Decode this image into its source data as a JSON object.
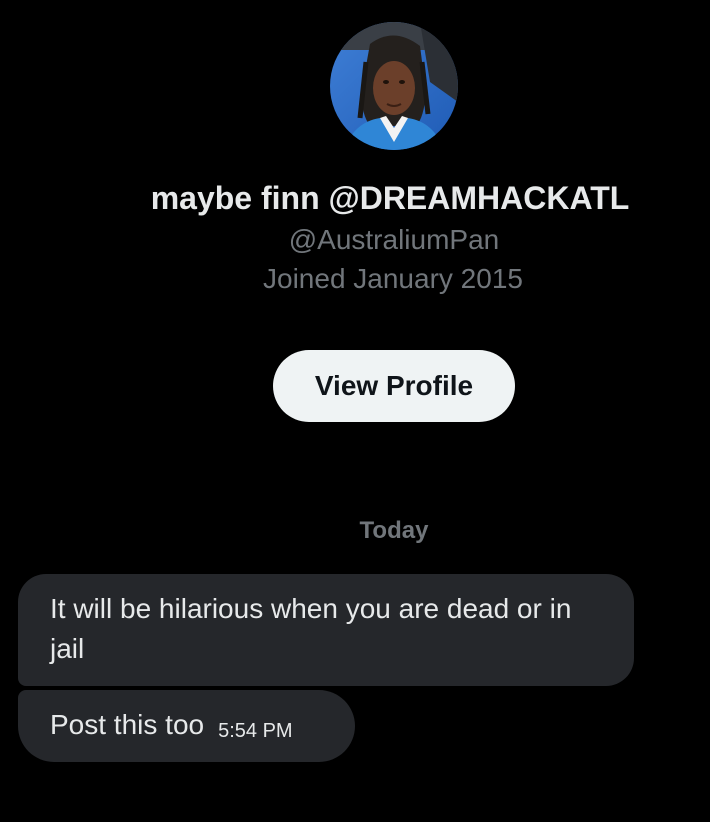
{
  "profile": {
    "display_name": "maybe finn @DREAMHACKATL",
    "handle": "@AustraliumPan",
    "joined": "Joined January 2015",
    "view_profile_label": "View Profile",
    "avatar_icon": "user-avatar-photo"
  },
  "conversation": {
    "date_divider": "Today",
    "messages": [
      {
        "text": "It will be hilarious when you are dead or in jail",
        "time": ""
      },
      {
        "text": "Post this too",
        "time": "5:54 PM"
      }
    ]
  },
  "colors": {
    "background": "#000000",
    "primary_text": "#e7e9ea",
    "secondary_text": "#71767b",
    "button_bg": "#eff3f4",
    "bubble_bg": "#25272b"
  }
}
